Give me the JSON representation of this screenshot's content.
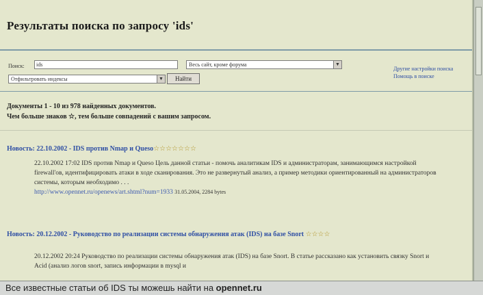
{
  "header": {
    "title": "Результаты поиска по запросу 'ids'"
  },
  "search": {
    "label": "Поиск:",
    "value": "ids",
    "scope_select": "Весь сайт, кроме форума",
    "filter_select": "Отфильтровать индексы",
    "button_label": "Найти"
  },
  "side_links": [
    "Другие настройки поиска",
    "Помощь в поиске"
  ],
  "summary": {
    "count_text": "Документы 1 - 10 из 978 найденных документов.",
    "hint_text": "Чем больше знаков ☆, тем больше совпадений с вашим запросом."
  },
  "results": [
    {
      "title": "Новость: 22.10.2002 - IDS против Nmap и Queso",
      "stars": "☆☆☆☆☆☆☆",
      "datetime": "22.10.2002 17:02",
      "snippet": "IDS против Nmap и Queso Цель данной статьи - помочь аналитикам IDS и администраторам, занимающимся настройкой firewall'ов, идентифицировать атаки в ходе сканирования. Это не развернутый анализ, а пример методики ориентированный на администраторов системы, которым необходимо . . .",
      "url": "http://www.opennet.ru/openews/art.shtml?num=1933",
      "meta": "31.05.2004, 2284 bytes"
    },
    {
      "title": "Новость: 20.12.2002 - Руководство по реализации системы обнаружения атак (IDS) на базе Snort",
      "stars": "☆☆☆☆",
      "datetime": "20.12.2002 20:24",
      "snippet": "Руководство по реализации системы обнаружения атак (IDS) на базе Snort. В статье рассказано как установить связку Snort и Acid (анализ логов snort, запись информации в mysql и"
    }
  ],
  "caption": {
    "text": "Все известные статьи об IDS ты можешь найти на ",
    "site": "opennet.ru"
  }
}
